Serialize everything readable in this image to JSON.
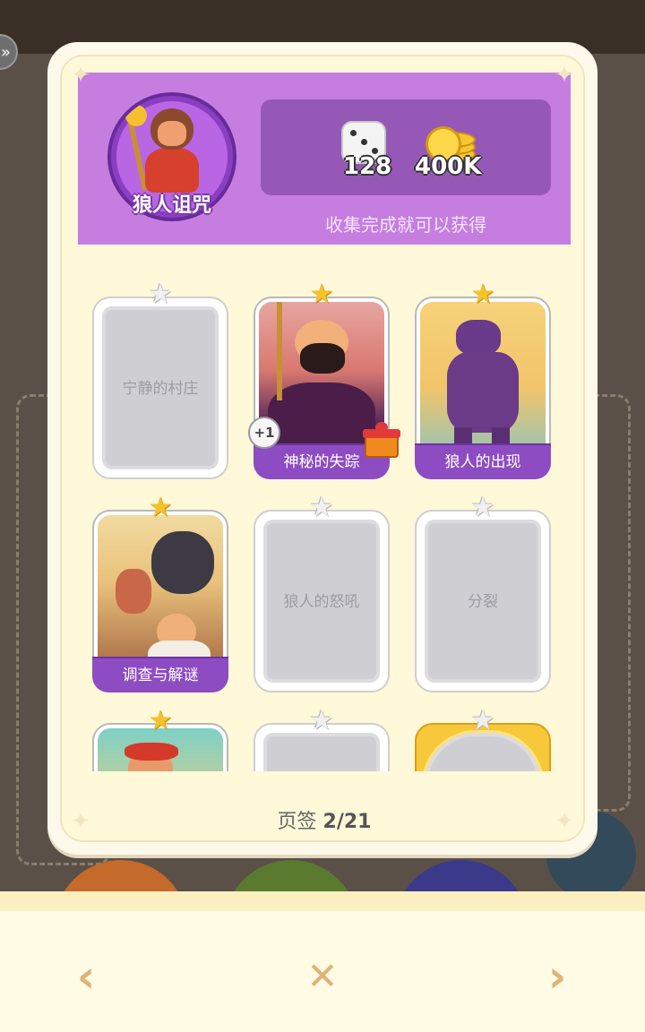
{
  "header": {
    "avatar_name": "狼人诅咒",
    "rewards": [
      {
        "icon": "dice-icon",
        "value": "128"
      },
      {
        "icon": "gold-coins-icon",
        "value": "400K"
      }
    ],
    "collect_text": "收集完成就可以获得"
  },
  "cards": [
    {
      "name": "宁静的村庄",
      "collected": false,
      "star": "gray"
    },
    {
      "name": "神秘的失踪",
      "collected": true,
      "star": "gold",
      "badge": "+1",
      "gift": true
    },
    {
      "name": "狼人的出现",
      "collected": true,
      "star": "gold"
    },
    {
      "name": "调查与解谜",
      "collected": true,
      "star": "gold"
    },
    {
      "name": "狼人的怒吼",
      "collected": false,
      "star": "gray"
    },
    {
      "name": "分裂",
      "collected": false,
      "star": "gray"
    },
    {
      "name": "",
      "collected": true,
      "star": "gold"
    },
    {
      "name": "",
      "collected": false,
      "star": "gray"
    },
    {
      "name": "",
      "collected": false,
      "star": "gray",
      "golden_frame": true
    }
  ],
  "pagination": {
    "label": "页签",
    "current": "2/21"
  },
  "nav": {
    "prev": "‹",
    "close": "✕",
    "next": "›"
  },
  "colors": {
    "header": "#c57de0",
    "label_purple": "#8d4cc2",
    "star_gold": "#f5c229"
  }
}
